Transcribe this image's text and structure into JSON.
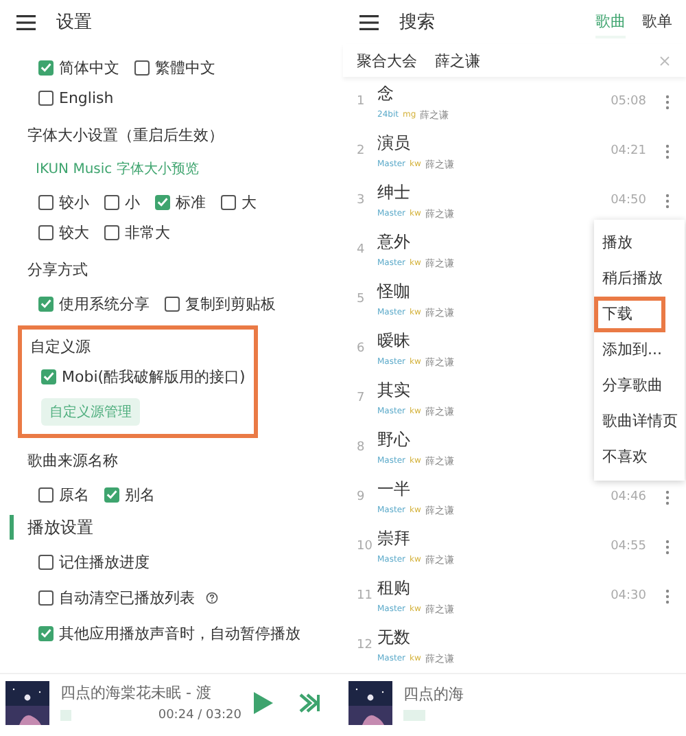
{
  "settings": {
    "title": "设置",
    "blocks": [
      {
        "kind": "checks",
        "rows": [
          [
            {
              "label": "简体中文",
              "checked": true
            },
            {
              "label": "繁體中文",
              "checked": false
            }
          ],
          [
            {
              "label": "English",
              "checked": false
            }
          ]
        ]
      },
      {
        "kind": "label",
        "text": "字体大小设置（重启后生效）"
      },
      {
        "kind": "preview",
        "text": "IKUN Music 字体大小预览"
      },
      {
        "kind": "checks",
        "rows": [
          [
            {
              "label": "较小",
              "checked": false
            },
            {
              "label": "小",
              "checked": false
            },
            {
              "label": "标准",
              "checked": true
            },
            {
              "label": "大",
              "checked": false
            }
          ],
          [
            {
              "label": "较大",
              "checked": false
            },
            {
              "label": "非常大",
              "checked": false
            }
          ]
        ]
      },
      {
        "kind": "label",
        "text": "分享方式"
      },
      {
        "kind": "checks",
        "rows": [
          [
            {
              "label": "使用系统分享",
              "checked": true
            },
            {
              "label": "复制到剪贴板",
              "checked": false
            }
          ]
        ]
      },
      {
        "kind": "group",
        "highlighted": true,
        "title": "自定义源",
        "options": [
          {
            "label": "Mobi(酷我破解版用的接口)",
            "checked": true
          }
        ],
        "button": "自定义源管理"
      },
      {
        "kind": "label",
        "text": "歌曲来源名称"
      },
      {
        "kind": "checks",
        "rows": [
          [
            {
              "label": "原名",
              "checked": false
            },
            {
              "label": "别名",
              "checked": true
            }
          ]
        ]
      },
      {
        "kind": "section",
        "text": "播放设置"
      },
      {
        "kind": "list",
        "rows": [
          [
            {
              "label": "记住播放进度",
              "checked": false
            }
          ],
          [
            {
              "label": "自动清空已播放列表",
              "checked": false,
              "help": true
            }
          ],
          [
            {
              "label": "其他应用播放声音时，自动暂停播放",
              "checked": true
            }
          ]
        ]
      }
    ],
    "player": {
      "title": "四点的海棠花未眠 - 渡",
      "time": "00:24 / 03:20",
      "level": 0.12
    }
  },
  "search": {
    "title": "搜索",
    "tabs": [
      {
        "label": "歌曲",
        "selected": true
      },
      {
        "label": "歌单",
        "selected": false
      }
    ],
    "query": {
      "source": "聚合大会",
      "value": "薛之谦"
    },
    "songs": [
      {
        "index": "1",
        "title": "念",
        "tags": [
          {
            "text": "24bit",
            "color": "#5aa9c9"
          },
          {
            "text": "mg",
            "color": "#d4b23c"
          }
        ],
        "artist": "薛之谦",
        "duration": "05:08"
      },
      {
        "index": "2",
        "title": "演员",
        "tags": [
          {
            "text": "Master",
            "color": "#5aa9c9"
          },
          {
            "text": "kw",
            "color": "#d4b23c"
          }
        ],
        "artist": "薛之谦",
        "duration": "04:21"
      },
      {
        "index": "3",
        "title": "绅士",
        "tags": [
          {
            "text": "Master",
            "color": "#5aa9c9"
          },
          {
            "text": "kw",
            "color": "#d4b23c"
          }
        ],
        "artist": "薛之谦",
        "duration": "04:50"
      },
      {
        "index": "4",
        "title": "意外",
        "tags": [
          {
            "text": "Master",
            "color": "#5aa9c9"
          },
          {
            "text": "kw",
            "color": "#d4b23c"
          }
        ],
        "artist": "薛之谦"
      },
      {
        "index": "5",
        "title": "怪咖",
        "tags": [
          {
            "text": "Master",
            "color": "#5aa9c9"
          },
          {
            "text": "kw",
            "color": "#d4b23c"
          }
        ],
        "artist": "薛之谦"
      },
      {
        "index": "6",
        "title": "暧昧",
        "tags": [
          {
            "text": "Master",
            "color": "#5aa9c9"
          },
          {
            "text": "kw",
            "color": "#d4b23c"
          }
        ],
        "artist": "薛之谦"
      },
      {
        "index": "7",
        "title": "其实",
        "tags": [
          {
            "text": "Master",
            "color": "#5aa9c9"
          },
          {
            "text": "kw",
            "color": "#d4b23c"
          }
        ],
        "artist": "薛之谦"
      },
      {
        "index": "8",
        "title": "野心",
        "tags": [
          {
            "text": "Master",
            "color": "#5aa9c9"
          },
          {
            "text": "kw",
            "color": "#d4b23c"
          }
        ],
        "artist": "薛之谦"
      },
      {
        "index": "9",
        "title": "一半",
        "tags": [
          {
            "text": "Master",
            "color": "#5aa9c9"
          },
          {
            "text": "kw",
            "color": "#d4b23c"
          }
        ],
        "artist": "薛之谦",
        "duration": "04:46"
      },
      {
        "index": "10",
        "title": "崇拜",
        "tags": [
          {
            "text": "Master",
            "color": "#5aa9c9"
          },
          {
            "text": "kw",
            "color": "#d4b23c"
          }
        ],
        "artist": "薛之谦",
        "duration": "04:55"
      },
      {
        "index": "11",
        "title": "租购",
        "tags": [
          {
            "text": "Master",
            "color": "#5aa9c9"
          },
          {
            "text": "kw",
            "color": "#d4b23c"
          }
        ],
        "artist": "薛之谦",
        "duration": "04:30"
      },
      {
        "index": "12",
        "title": "无数",
        "tags": [
          {
            "text": "Master",
            "color": "#5aa9c9"
          },
          {
            "text": "kw",
            "color": "#d4b23c"
          }
        ],
        "artist": "薛之谦"
      }
    ],
    "menu": [
      {
        "label": "播放",
        "highlighted": false
      },
      {
        "label": "稍后播放",
        "highlighted": false
      },
      {
        "label": "下载",
        "highlighted": true
      },
      {
        "label": "添加到...",
        "highlighted": false
      },
      {
        "label": "分享歌曲",
        "highlighted": false
      },
      {
        "label": "歌曲详情页",
        "highlighted": false
      },
      {
        "label": "不喜欢",
        "highlighted": false
      }
    ],
    "player": {
      "title": "四点的海"
    }
  }
}
